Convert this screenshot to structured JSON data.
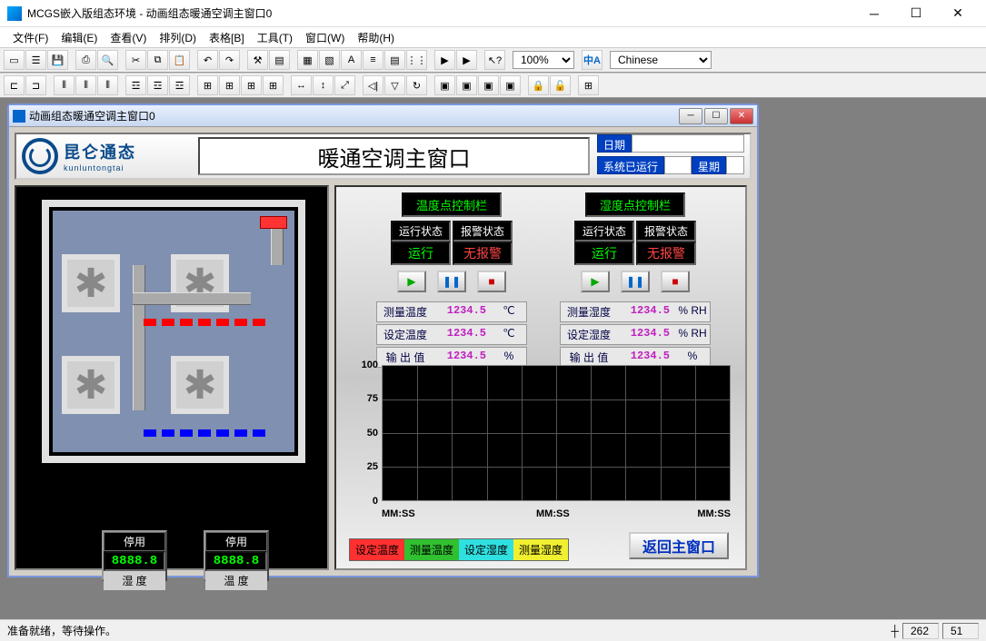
{
  "app": {
    "title": "MCGS嵌入版组态环境 - 动画组态暖通空调主窗口0"
  },
  "menu": {
    "file": "文件(F)",
    "edit": "编辑(E)",
    "view": "查看(V)",
    "arrange": "排列(D)",
    "table": "表格[B]",
    "tools": "工具(T)",
    "window": "窗口(W)",
    "help": "帮助(H)"
  },
  "toolbar": {
    "zoom": "100%",
    "language": "Chinese"
  },
  "inner": {
    "title": "动画组态暖通空调主窗口0"
  },
  "header": {
    "logo_cn": "昆仑通态",
    "logo_en": "kunluntongtai",
    "main_title": "暖通空调主窗口",
    "date_label": "日期",
    "runtime_label": "系统已运行",
    "week_label": "星期"
  },
  "gauges": {
    "disabled": "停用",
    "value": "8888.8",
    "humidity": "湿 度",
    "temperature": "温 度"
  },
  "control_temp": {
    "title": "温度点控制栏",
    "run_status_label": "运行状态",
    "alarm_status_label": "报警状态",
    "running": "运行",
    "no_alarm": "无报警",
    "rows": [
      {
        "label": "测量温度",
        "value": "1234.5",
        "unit": "℃"
      },
      {
        "label": "设定温度",
        "value": "1234.5",
        "unit": "℃"
      },
      {
        "label": "输 出 值",
        "value": "1234.5",
        "unit": "%"
      }
    ]
  },
  "control_hum": {
    "title": "湿度点控制栏",
    "run_status_label": "运行状态",
    "alarm_status_label": "报警状态",
    "running": "运行",
    "no_alarm": "无报警",
    "rows": [
      {
        "label": "测量湿度",
        "value": "1234.5",
        "unit": "% RH"
      },
      {
        "label": "设定湿度",
        "value": "1234.5",
        "unit": "% RH"
      },
      {
        "label": "输 出 值",
        "value": "1234.5",
        "unit": "%"
      }
    ]
  },
  "chart_data": {
    "type": "line",
    "title": "",
    "xlabel": "MM:SS",
    "ylabel": "",
    "ylim": [
      0,
      100
    ],
    "y_ticks": [
      0,
      25,
      50,
      75,
      100
    ],
    "x_ticks": [
      "MM:SS",
      "MM:SS",
      "MM:SS"
    ],
    "series": [
      {
        "name": "设定温度",
        "color": "#ff3030",
        "values": []
      },
      {
        "name": "测量温度",
        "color": "#30c030",
        "values": []
      },
      {
        "name": "设定湿度",
        "color": "#30e0e0",
        "values": []
      },
      {
        "name": "测量湿度",
        "color": "#f0f030",
        "values": []
      }
    ]
  },
  "return_button": "返回主窗口",
  "statusbar": {
    "ready": "准备就绪，等待操作。",
    "x": "262",
    "y": "51"
  }
}
